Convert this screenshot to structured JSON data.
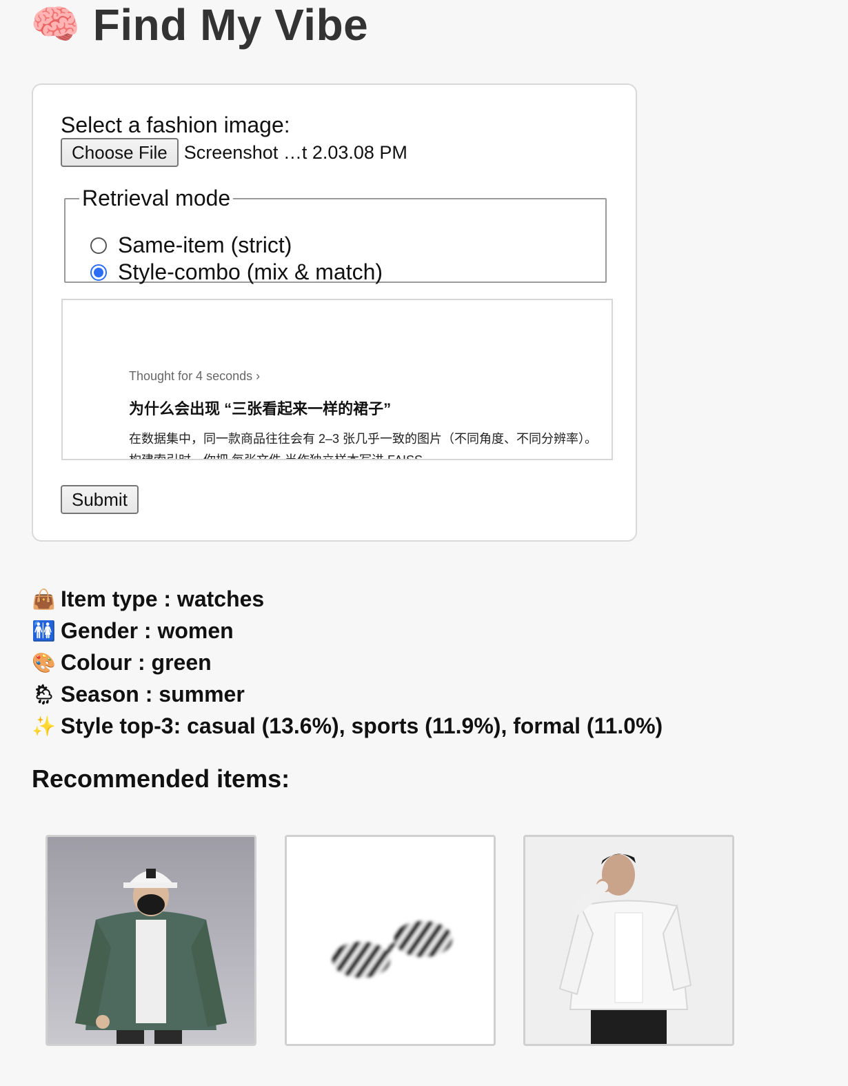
{
  "header": {
    "icon": "brain-icon",
    "title": "Find My Vibe"
  },
  "form": {
    "select_label": "Select a fashion image:",
    "choose_file_label": "Choose File",
    "file_name": "Screenshot …t 2.03.08 PM",
    "mode_legend": "Retrieval mode",
    "modes": [
      {
        "label": "Same-item (strict)",
        "checked": false
      },
      {
        "label": "Style-combo (mix & match)",
        "checked": true
      }
    ],
    "preview": {
      "thought": "Thought for 4 seconds",
      "heading": "为什么会出现 “三张看起来一样的裙子”",
      "line1": "在数据集中，同一款商品往往会有 2–3 张几乎一致的图片（不同角度、不同分辨率）。",
      "line2": "构建索引时，你把 每张文件 当作独立样本写进 FAISS"
    },
    "submit_label": "Submit"
  },
  "results": {
    "item_type": "Item type : watches",
    "gender": "Gender : women",
    "colour": "Colour : green",
    "season": "Season : summer",
    "style": "Style top-3: casual (13.6%), sports (11.9%), formal (11.0%)",
    "icons": [
      "handbag-icon",
      "restroom-icon",
      "palette-icon",
      "cloud-sun-rain-icon",
      "sparkles-icon"
    ]
  },
  "recommended": {
    "heading": "Recommended items:",
    "items": [
      {
        "name": "green-jacket-image"
      },
      {
        "name": "sunglasses-image"
      },
      {
        "name": "white-jacket-image"
      }
    ]
  }
}
